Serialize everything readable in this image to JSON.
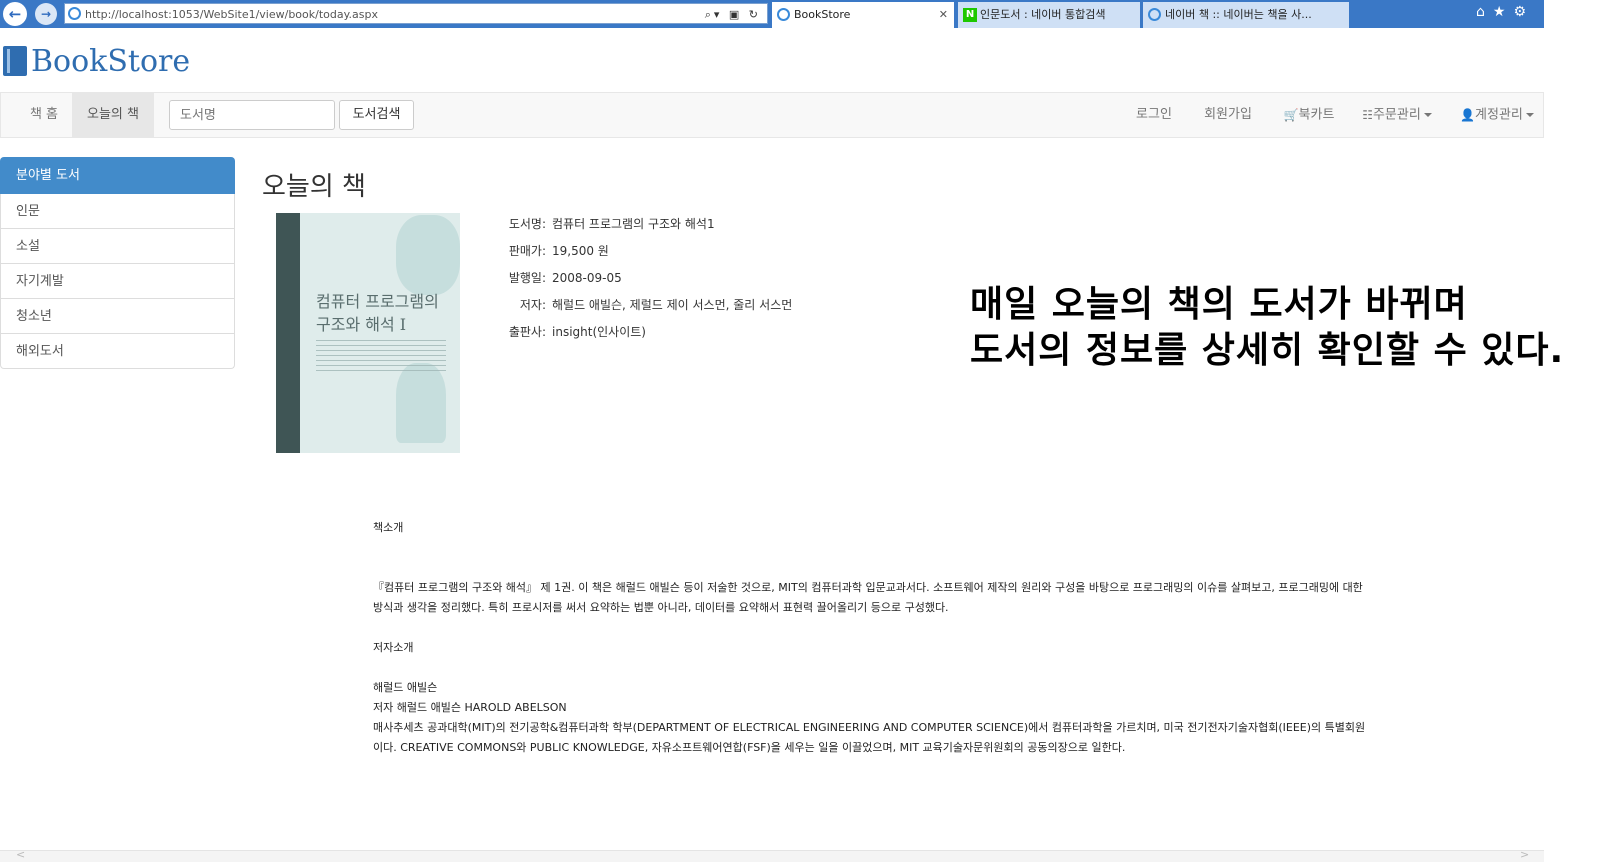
{
  "browser": {
    "url": "http://localhost:1053/WebSite1/view/book/today.aspx",
    "tabs": [
      {
        "label": "BookStore"
      },
      {
        "label": "인문도서 : 네이버 통합검색"
      },
      {
        "label": "네이버 책 :: 네이버는 책을 사..."
      }
    ]
  },
  "brand": {
    "name": "BookStore"
  },
  "navbar": {
    "home": "책 홈",
    "today": "오늘의 책",
    "search_placeholder": "도서명",
    "search_button": "도서검색",
    "login": "로그인",
    "signup": "회원가입",
    "cart": "북카트",
    "orders": "주문관리",
    "account": "계정관리"
  },
  "sidebar": {
    "items": [
      {
        "label": "분야별 도서"
      },
      {
        "label": "인문"
      },
      {
        "label": "소설"
      },
      {
        "label": "자기계발"
      },
      {
        "label": "청소년"
      },
      {
        "label": "해외도서"
      }
    ]
  },
  "main": {
    "title": "오늘의 책",
    "cover_title": "컴퓨터 프로그램의 구조와 해석 I",
    "info": [
      {
        "label": "도서명:",
        "value": "컴퓨터 프로그램의 구조와 해석1"
      },
      {
        "label": "판매가:",
        "value": "19,500 원"
      },
      {
        "label": "발행일:",
        "value": "2008-09-05"
      },
      {
        "label": "저자:",
        "value": "해럴드 애빌슨, 제럴드 제이 서스먼, 줄리 서스먼"
      },
      {
        "label": "출판사:",
        "value": "insight(인사이트)"
      }
    ],
    "overlay": {
      "line1": "매일 오늘의 책의 도서가 바뀌며",
      "line2": "도서의 정보를 상세히 확인할 수 있다."
    },
    "intro_heading": "책소개",
    "intro_text": "『컴퓨터 프로그램의 구조와 해석』 제 1권. 이 책은 해럴드 애빌슨 등이 저술한 것으로, MIT의 컴퓨터과학 입문교과서다. 소프트웨어 제작의 원리와 구성을 바탕으로 프로그래밍의 이슈를 살펴보고, 프로그래밍에 대한 방식과 생각을 정리했다. 특히 프로시저를 써서 요약하는 법뿐 아니라, 데이터를 요약해서 표현력 끌어올리기 등으로 구성했다.",
    "author_heading": "저자소개",
    "author_name": "해럴드 애빌슨",
    "author_line": "저자 해럴드 애빌슨 HAROLD ABELSON",
    "author_bio": "매사추세츠 공과대학(MIT)의 전기공학&컴퓨터과학 학부(DEPARTMENT OF ELECTRICAL ENGINEERING AND COMPUTER SCIENCE)에서 컴퓨터과학을 가르치며, 미국 전기전자기술자협회(IEEE)의 특별회원이다. CREATIVE COMMONS와 PUBLIC KNOWLEDGE, 자유소프트웨어연합(FSF)을 세우는 일을 이끌었으며, MIT 교육기술자문위원회의 공동의장으로 일한다."
  }
}
